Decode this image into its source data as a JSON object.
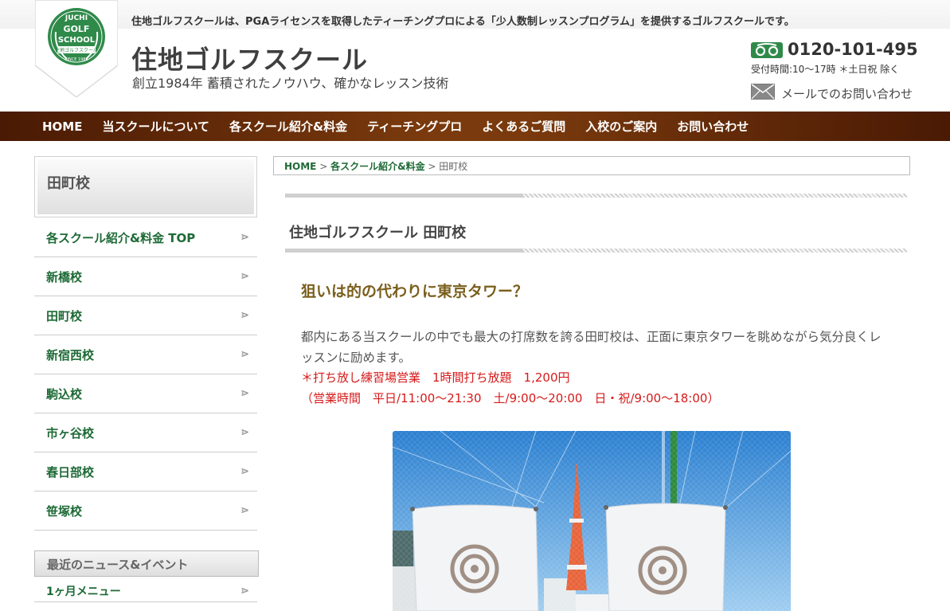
{
  "header": {
    "tagline": "住地ゴルフスクールは、PGAライセンスを取得したティーチングプロによる「少人数制レッスンプログラム」を提供するゴルフスクールです。",
    "logo": {
      "line1": "JUCHI",
      "line2": "GOLF",
      "line3": "SCHOOL",
      "ribbon": "住地ゴルフスクール",
      "since": "SINCE 1984"
    },
    "site_title": "住地ゴルフスクール",
    "site_subtitle": "創立1984年 蓄積されたノウハウ、確かなレッスン技術",
    "phone_number": "0120-101-495",
    "phone_hours": "受付時間:10〜17時 ＊土日祝 除く",
    "mail_label": "メールでのお問い合わせ",
    "icons": {
      "phone": "freedial-icon",
      "mail": "envelope-icon"
    }
  },
  "nav": {
    "items": [
      "HOME",
      "当スクールについて",
      "各スクール紹介&料金",
      "ティーチングプロ",
      "よくあるご質問",
      "入校のご案内",
      "お問い合わせ"
    ]
  },
  "sidebar": {
    "title": "田町校",
    "items": [
      "各スクール紹介&料金 TOP",
      "新橋校",
      "田町校",
      "新宿西校",
      "駒込校",
      "市ヶ谷校",
      "春日部校",
      "笹塚校"
    ],
    "news_heading": "最近のニュース&イベント",
    "news_items": [
      "1ヶ月メニュー"
    ]
  },
  "breadcrumb": {
    "home": "HOME",
    "sep1": ">",
    "parent": "各スクール紹介&料金",
    "sep2": ">",
    "current": "田町校"
  },
  "main": {
    "page_title": "住地ゴルフスクール 田町校",
    "catch": "狙いは的の代わりに東京タワー？",
    "body": "都内にある当スクールの中でも最大の打席数を誇る田町校は、正面に東京タワーを眺めながら気分良くレッスンに励めます。",
    "notice_line1": "＊打ち放し練習場営業　1時間打ち放題　1,200円",
    "notice_line2": "（営業時間　平日/11:00〜21:30　土/9:00〜20:00　日・祝/9:00〜18:00）"
  },
  "colors": {
    "nav_brown": "#6b2e09",
    "link_green": "#1e6a36",
    "catch_gold": "#7a5e1c",
    "notice_red": "#d61a1a"
  }
}
